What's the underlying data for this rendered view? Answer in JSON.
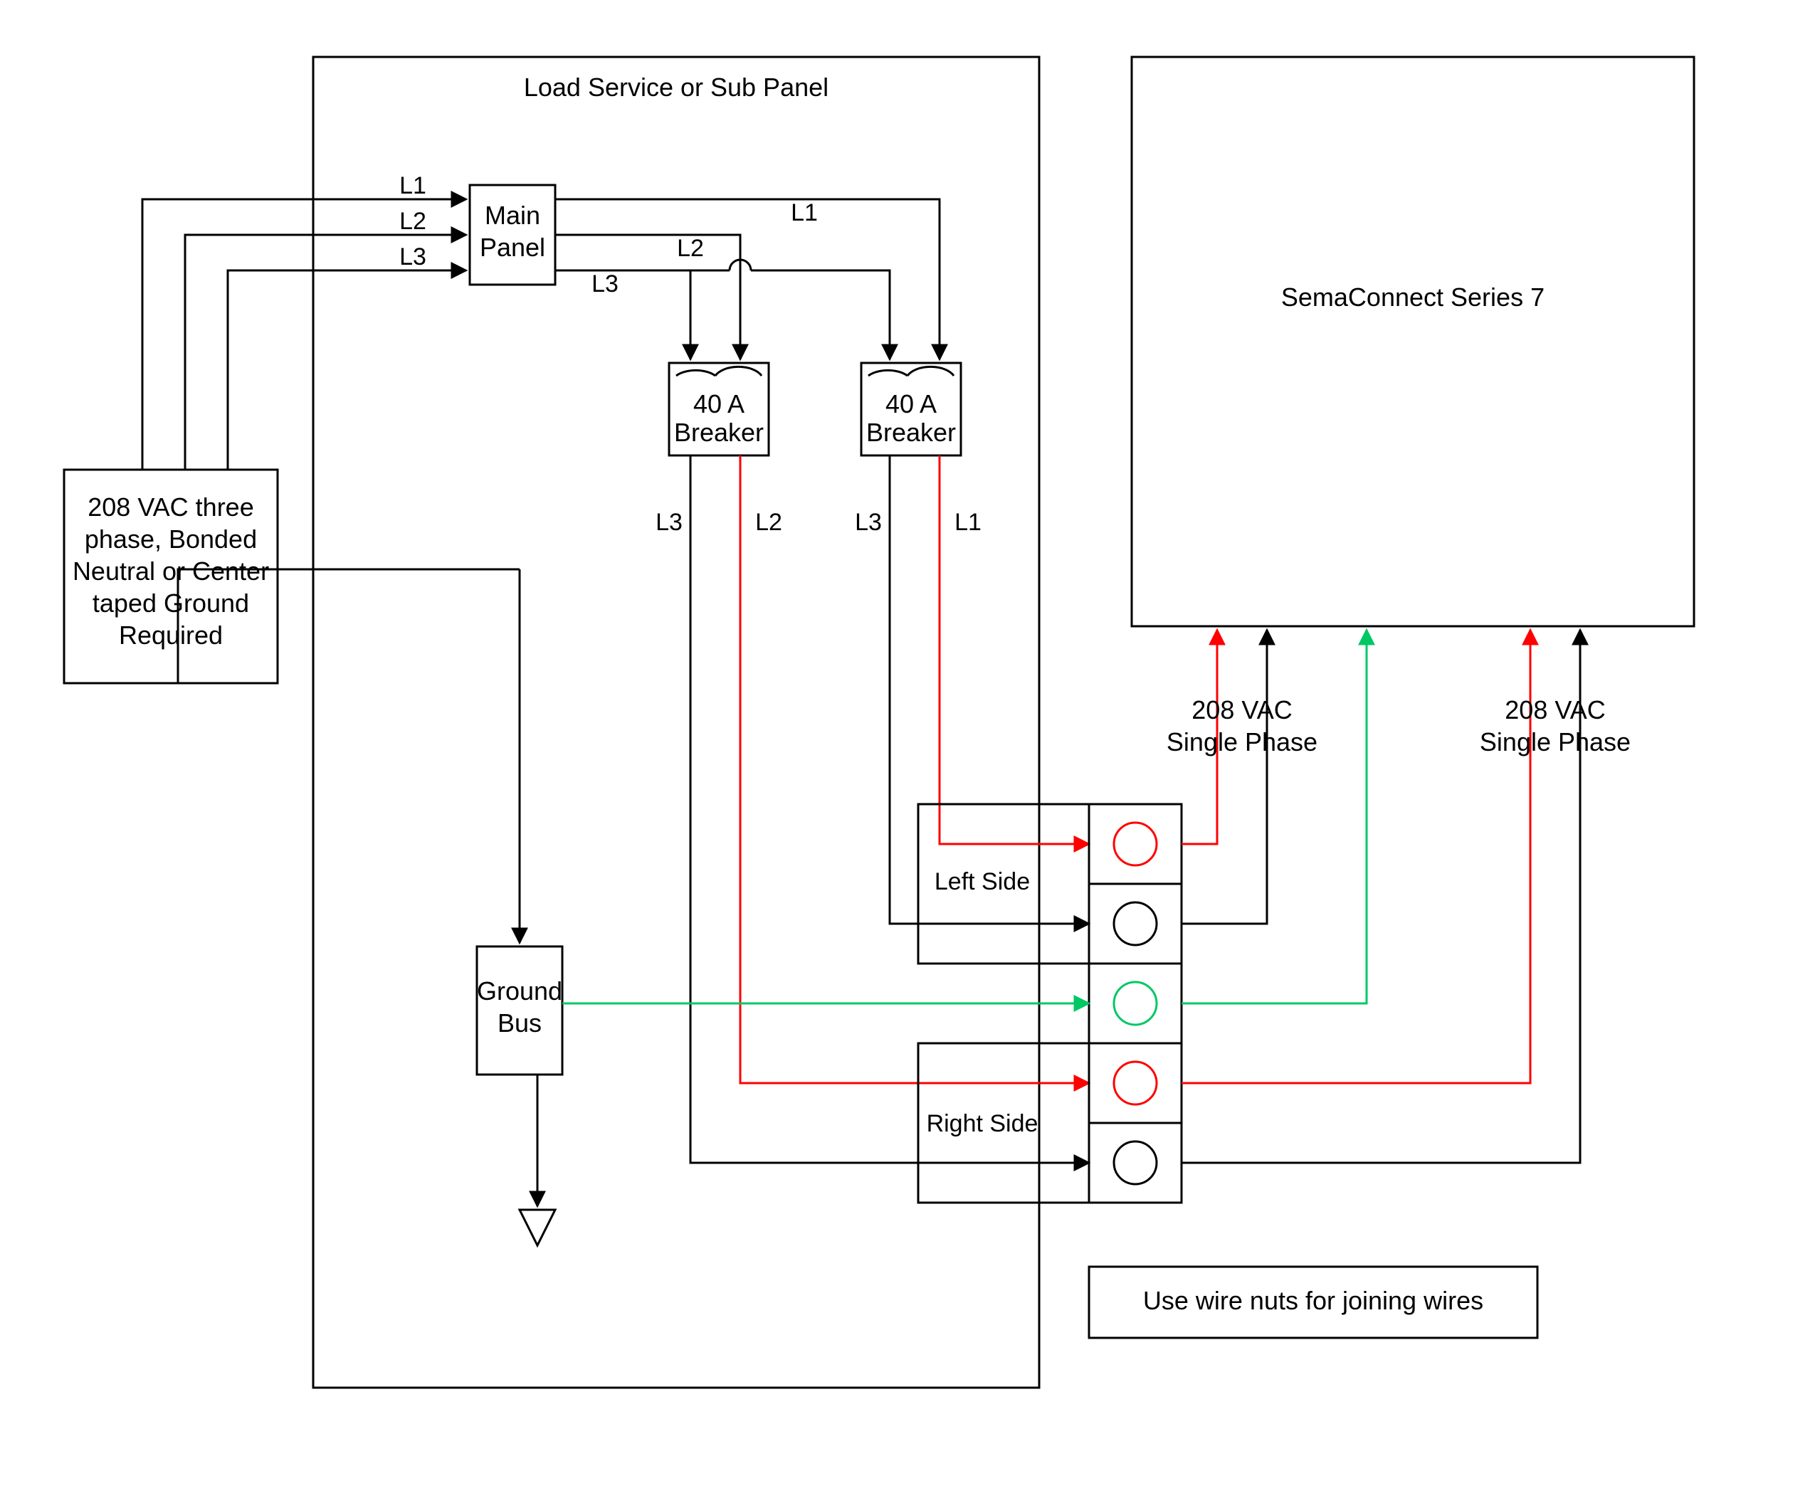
{
  "panel": {
    "title": "Load Service or Sub Panel",
    "mainPanel": "Main Panel",
    "breaker1": "40 A Breaker",
    "breaker2": "40 A Breaker",
    "groundBus": "Ground Bus",
    "leftSide": "Left Side",
    "rightSide": "Right Side"
  },
  "source": {
    "line1": "208 VAC three",
    "line2": "phase, Bonded",
    "line3": "Neutral or Center",
    "line4": "taped Ground",
    "line5": "Required"
  },
  "wires": {
    "l1": "L1",
    "l2": "L2",
    "l3": "L3"
  },
  "output": {
    "device": "SemaConnect Series 7",
    "phase1": "208 VAC Single Phase",
    "phase2": "208 VAC Single Phase",
    "footer": "Use wire nuts for joining wires"
  },
  "colors": {
    "red": "#ff0000",
    "green": "#00c864",
    "black": "#000000"
  }
}
